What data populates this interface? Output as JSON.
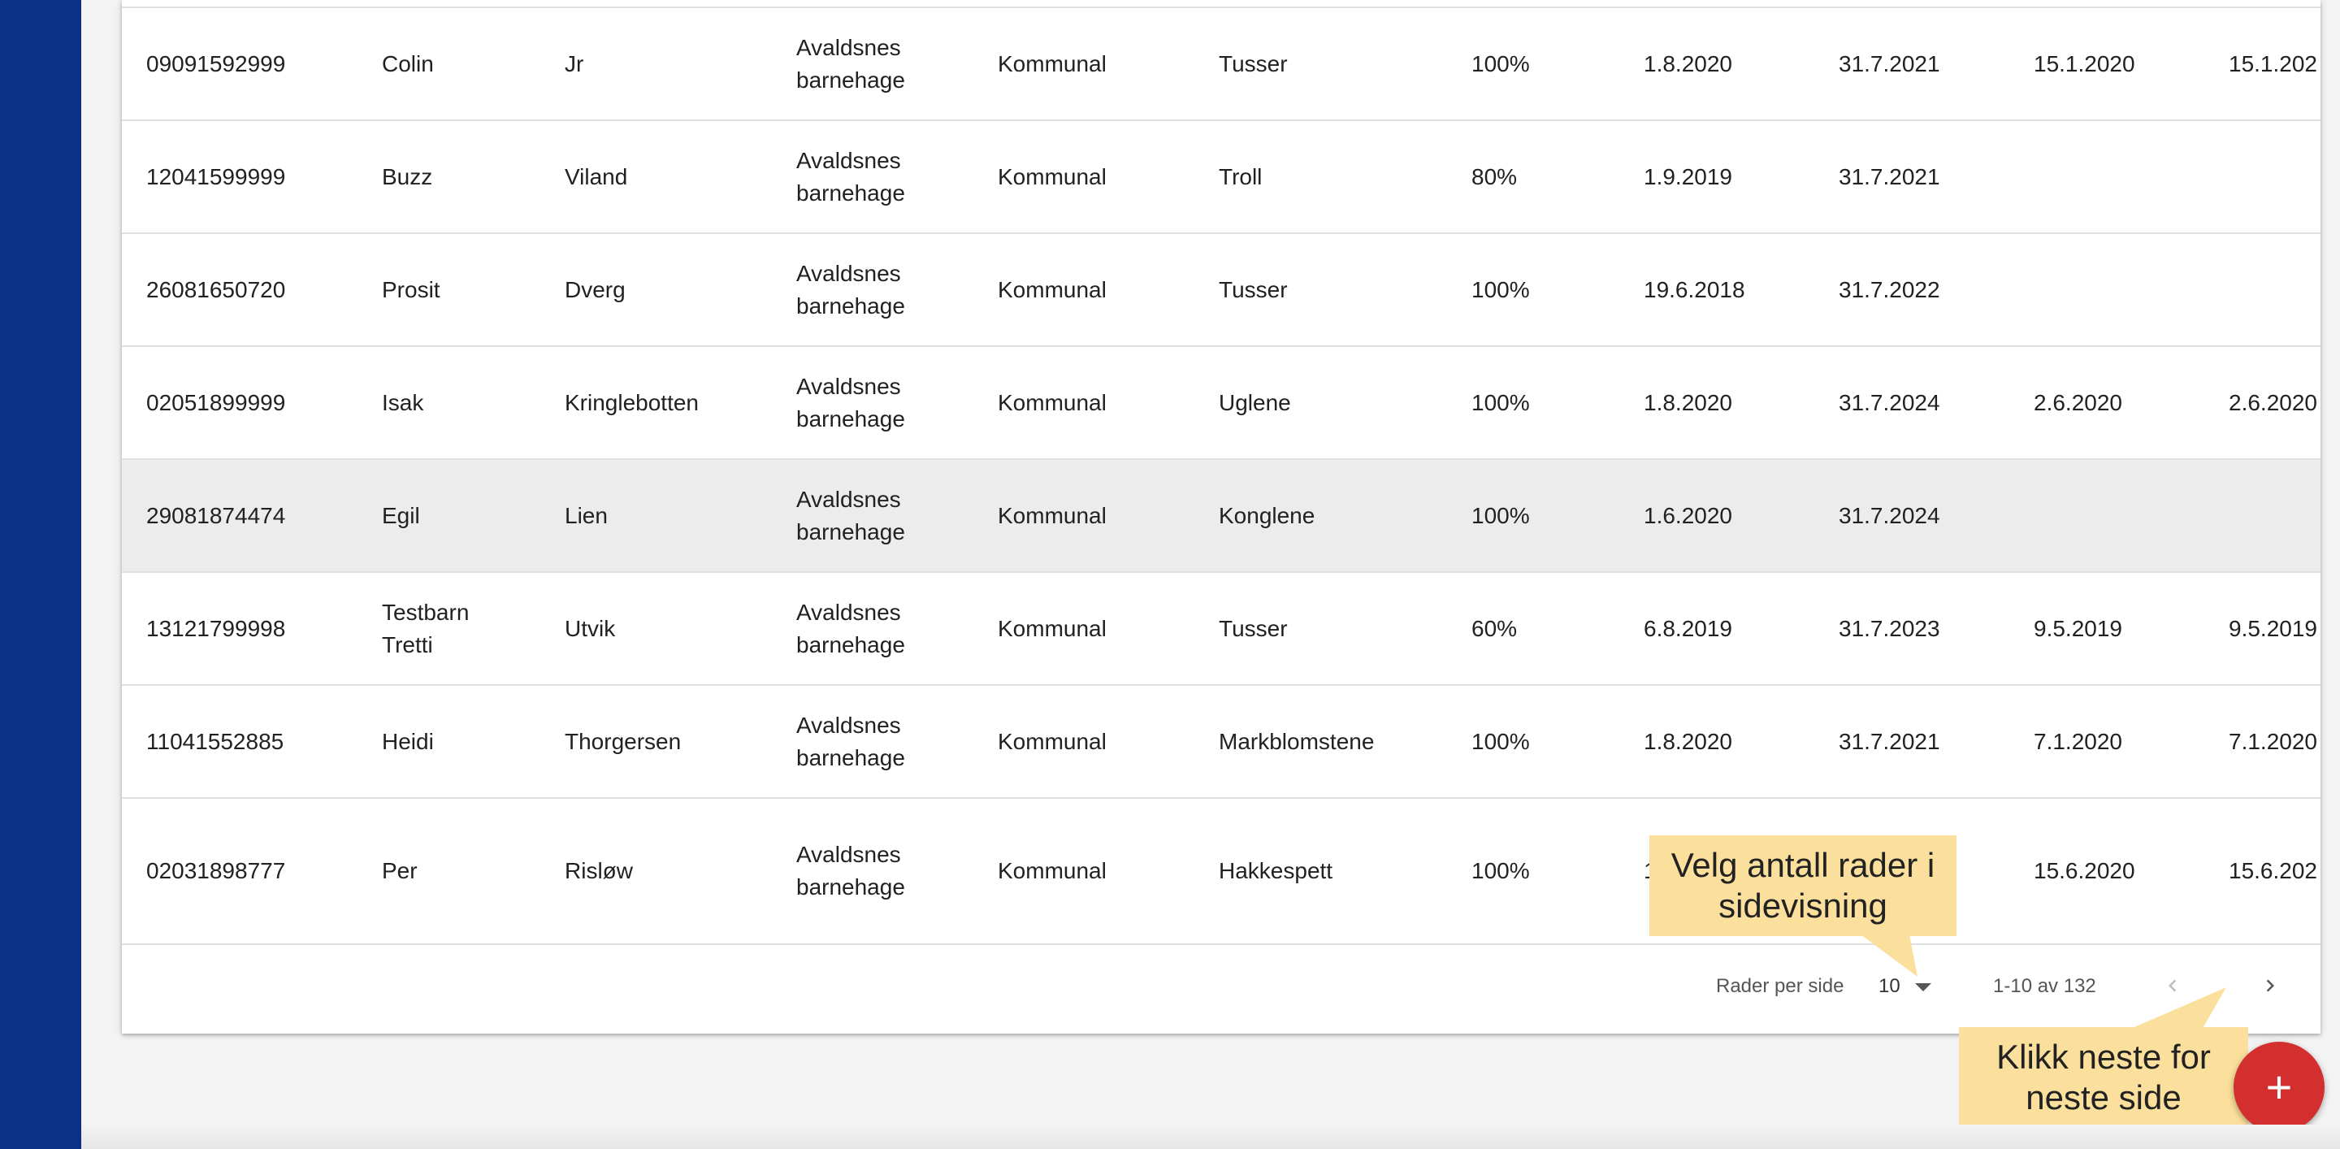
{
  "colors": {
    "sidebar": "#0b3186",
    "highlight_row": "#ececec",
    "callout": "#fbdf9c",
    "fab": "#d32f2f"
  },
  "table": {
    "rows": [
      [
        "09091592999",
        "Colin",
        "Jr",
        "Avaldsnes\nbarnehage",
        "Kommunal",
        "Tusser",
        "100%",
        "1.8.2020",
        "31.7.2021",
        "15.1.2020",
        "15.1.202"
      ],
      [
        "12041599999",
        "Buzz",
        "Viland",
        "Avaldsnes\nbarnehage",
        "Kommunal",
        "Troll",
        "80%",
        "1.9.2019",
        "31.7.2021",
        "",
        ""
      ],
      [
        "26081650720",
        "Prosit",
        "Dverg",
        "Avaldsnes\nbarnehage",
        "Kommunal",
        "Tusser",
        "100%",
        "19.6.2018",
        "31.7.2022",
        "",
        ""
      ],
      [
        "02051899999",
        "Isak",
        "Kringlebotten",
        "Avaldsnes\nbarnehage",
        "Kommunal",
        "Uglene",
        "100%",
        "1.8.2020",
        "31.7.2024",
        "2.6.2020",
        "2.6.2020"
      ],
      [
        "29081874474",
        "Egil",
        "Lien",
        "Avaldsnes\nbarnehage",
        "Kommunal",
        "Konglene",
        "100%",
        "1.6.2020",
        "31.7.2024",
        "",
        ""
      ],
      [
        "13121799998",
        "Testbarn\nTretti",
        "Utvik",
        "Avaldsnes\nbarnehage",
        "Kommunal",
        "Tusser",
        "60%",
        "6.8.2019",
        "31.7.2023",
        "9.5.2019",
        "9.5.2019"
      ],
      [
        "11041552885",
        "Heidi",
        "Thorgersen",
        "Avaldsnes\nbarnehage",
        "Kommunal",
        "Markblomstene",
        "100%",
        "1.8.2020",
        "31.7.2021",
        "7.1.2020",
        "7.1.2020"
      ],
      [
        "02031898777",
        "Per",
        "Risløw",
        "Avaldsnes\nbarnehage",
        "Kommunal",
        "Hakkespett",
        "100%",
        "1",
        "",
        "15.6.2020",
        "15.6.202"
      ]
    ]
  },
  "pagination": {
    "rows_per_page_label": "Rader per side",
    "rows_per_page_value": "10",
    "range_label": "1-10 av 132",
    "prev_icon": "chevron-left-icon",
    "next_icon": "chevron-right-icon"
  },
  "callouts": {
    "rows": "Velg antall rader i\nsidevisning",
    "next": "Klikk neste for\nneste side"
  },
  "fab": {
    "icon": "plus-icon",
    "label": "+"
  }
}
